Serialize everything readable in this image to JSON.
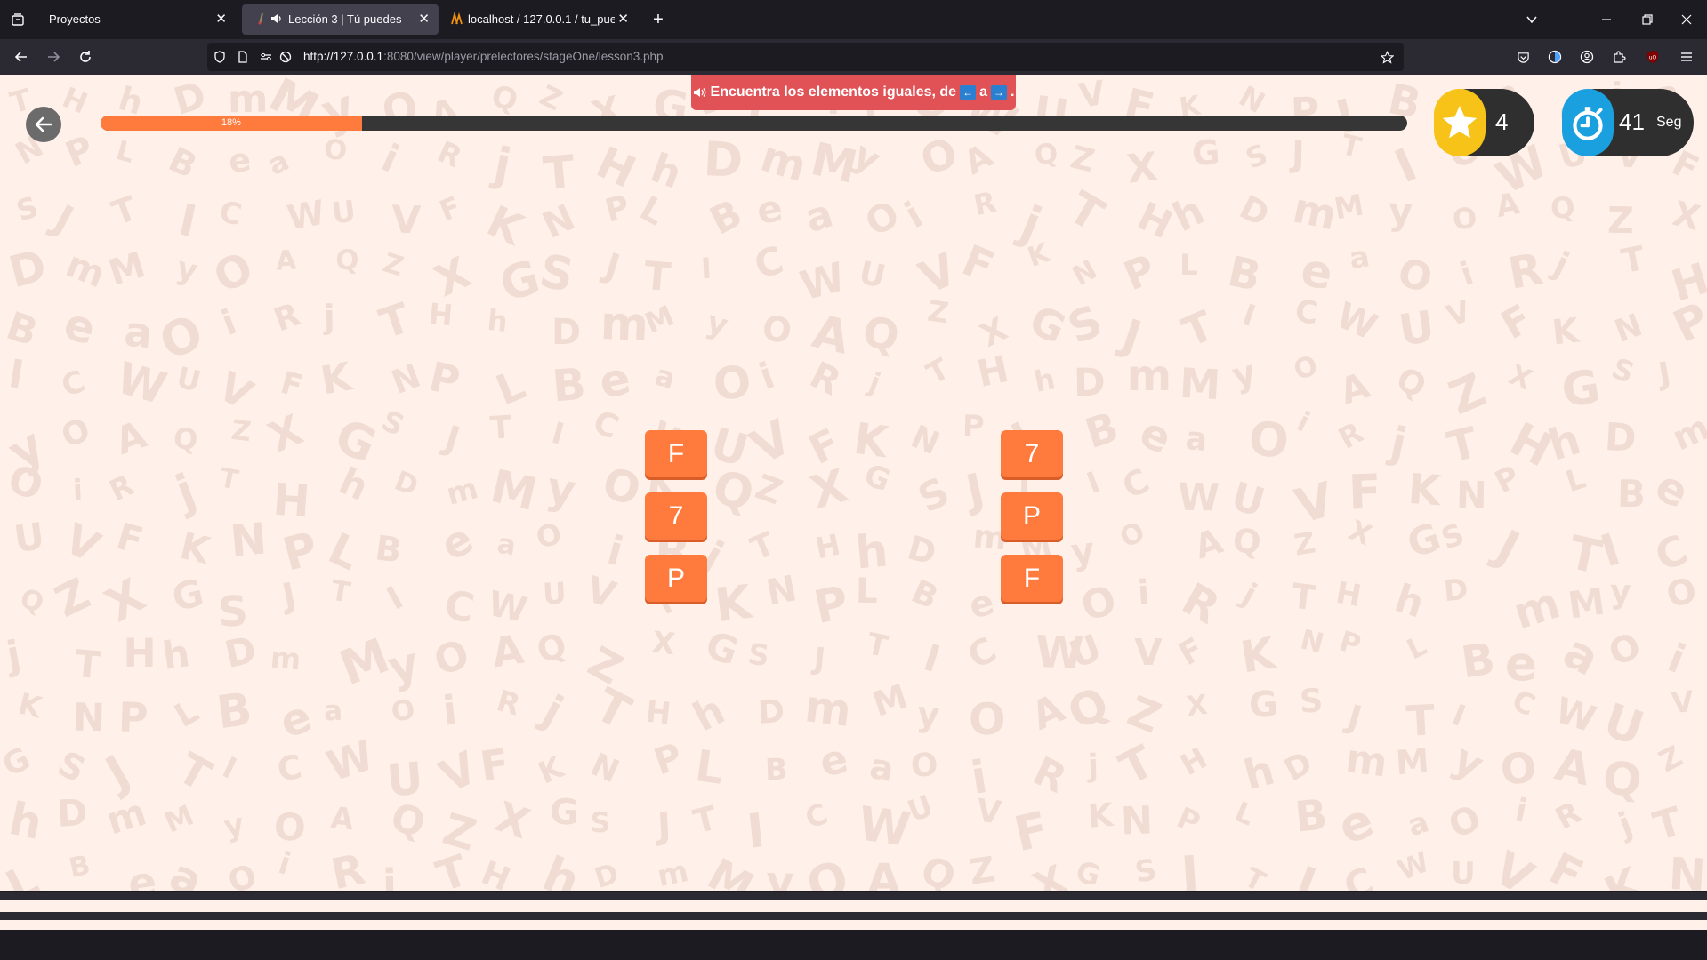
{
  "browser": {
    "tabs": [
      {
        "title": "Proyectos",
        "active": false
      },
      {
        "title": "Lección 3 | Tú puedes",
        "active": true,
        "audio": true
      },
      {
        "title": "localhost / 127.0.0.1 / tu_puede",
        "active": false
      }
    ],
    "url_host": "http://127.0.0.1",
    "url_path": ":8080/view/player/prelectores/stageOne/lesson3.php"
  },
  "game": {
    "instruction_prefix": "Encuentra los elementos iguales, de",
    "instruction_mid": "a",
    "instruction_suffix": ".",
    "left_arrow": "←",
    "right_arrow": "→",
    "progress_label": "18%",
    "progress_value": 0.2,
    "stars": "4",
    "timer_value": "41",
    "timer_unit": "Seg",
    "left_column": [
      "F",
      "7",
      "P"
    ],
    "right_column": [
      "7",
      "P",
      "F"
    ]
  },
  "colors": {
    "accent": "#ff7a3d",
    "background": "#fff1ea",
    "instruction_bg": "#e05256",
    "star": "#f7c318",
    "timer": "#1aa0df"
  },
  "background_letters": "TUMPZOTHVyLXiIhFOBGRCDKAeSjWmNQaJ"
}
